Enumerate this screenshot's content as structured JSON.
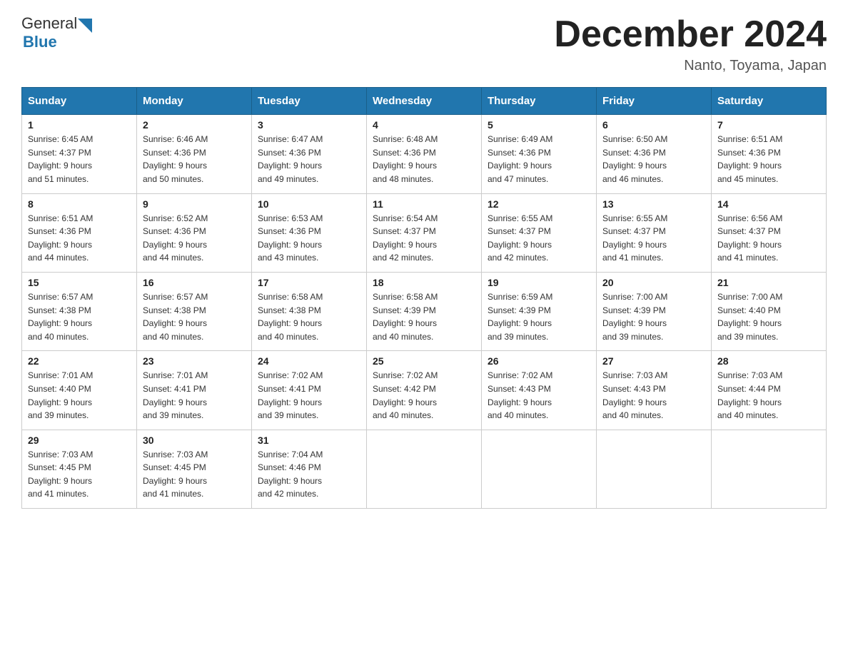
{
  "header": {
    "logo_general": "General",
    "logo_blue": "Blue",
    "month_title": "December 2024",
    "location": "Nanto, Toyama, Japan"
  },
  "columns": [
    "Sunday",
    "Monday",
    "Tuesday",
    "Wednesday",
    "Thursday",
    "Friday",
    "Saturday"
  ],
  "weeks": [
    [
      {
        "day": "1",
        "sunrise": "6:45 AM",
        "sunset": "4:37 PM",
        "daylight": "9 hours and 51 minutes."
      },
      {
        "day": "2",
        "sunrise": "6:46 AM",
        "sunset": "4:36 PM",
        "daylight": "9 hours and 50 minutes."
      },
      {
        "day": "3",
        "sunrise": "6:47 AM",
        "sunset": "4:36 PM",
        "daylight": "9 hours and 49 minutes."
      },
      {
        "day": "4",
        "sunrise": "6:48 AM",
        "sunset": "4:36 PM",
        "daylight": "9 hours and 48 minutes."
      },
      {
        "day": "5",
        "sunrise": "6:49 AM",
        "sunset": "4:36 PM",
        "daylight": "9 hours and 47 minutes."
      },
      {
        "day": "6",
        "sunrise": "6:50 AM",
        "sunset": "4:36 PM",
        "daylight": "9 hours and 46 minutes."
      },
      {
        "day": "7",
        "sunrise": "6:51 AM",
        "sunset": "4:36 PM",
        "daylight": "9 hours and 45 minutes."
      }
    ],
    [
      {
        "day": "8",
        "sunrise": "6:51 AM",
        "sunset": "4:36 PM",
        "daylight": "9 hours and 44 minutes."
      },
      {
        "day": "9",
        "sunrise": "6:52 AM",
        "sunset": "4:36 PM",
        "daylight": "9 hours and 44 minutes."
      },
      {
        "day": "10",
        "sunrise": "6:53 AM",
        "sunset": "4:36 PM",
        "daylight": "9 hours and 43 minutes."
      },
      {
        "day": "11",
        "sunrise": "6:54 AM",
        "sunset": "4:37 PM",
        "daylight": "9 hours and 42 minutes."
      },
      {
        "day": "12",
        "sunrise": "6:55 AM",
        "sunset": "4:37 PM",
        "daylight": "9 hours and 42 minutes."
      },
      {
        "day": "13",
        "sunrise": "6:55 AM",
        "sunset": "4:37 PM",
        "daylight": "9 hours and 41 minutes."
      },
      {
        "day": "14",
        "sunrise": "6:56 AM",
        "sunset": "4:37 PM",
        "daylight": "9 hours and 41 minutes."
      }
    ],
    [
      {
        "day": "15",
        "sunrise": "6:57 AM",
        "sunset": "4:38 PM",
        "daylight": "9 hours and 40 minutes."
      },
      {
        "day": "16",
        "sunrise": "6:57 AM",
        "sunset": "4:38 PM",
        "daylight": "9 hours and 40 minutes."
      },
      {
        "day": "17",
        "sunrise": "6:58 AM",
        "sunset": "4:38 PM",
        "daylight": "9 hours and 40 minutes."
      },
      {
        "day": "18",
        "sunrise": "6:58 AM",
        "sunset": "4:39 PM",
        "daylight": "9 hours and 40 minutes."
      },
      {
        "day": "19",
        "sunrise": "6:59 AM",
        "sunset": "4:39 PM",
        "daylight": "9 hours and 39 minutes."
      },
      {
        "day": "20",
        "sunrise": "7:00 AM",
        "sunset": "4:39 PM",
        "daylight": "9 hours and 39 minutes."
      },
      {
        "day": "21",
        "sunrise": "7:00 AM",
        "sunset": "4:40 PM",
        "daylight": "9 hours and 39 minutes."
      }
    ],
    [
      {
        "day": "22",
        "sunrise": "7:01 AM",
        "sunset": "4:40 PM",
        "daylight": "9 hours and 39 minutes."
      },
      {
        "day": "23",
        "sunrise": "7:01 AM",
        "sunset": "4:41 PM",
        "daylight": "9 hours and 39 minutes."
      },
      {
        "day": "24",
        "sunrise": "7:02 AM",
        "sunset": "4:41 PM",
        "daylight": "9 hours and 39 minutes."
      },
      {
        "day": "25",
        "sunrise": "7:02 AM",
        "sunset": "4:42 PM",
        "daylight": "9 hours and 40 minutes."
      },
      {
        "day": "26",
        "sunrise": "7:02 AM",
        "sunset": "4:43 PM",
        "daylight": "9 hours and 40 minutes."
      },
      {
        "day": "27",
        "sunrise": "7:03 AM",
        "sunset": "4:43 PM",
        "daylight": "9 hours and 40 minutes."
      },
      {
        "day": "28",
        "sunrise": "7:03 AM",
        "sunset": "4:44 PM",
        "daylight": "9 hours and 40 minutes."
      }
    ],
    [
      {
        "day": "29",
        "sunrise": "7:03 AM",
        "sunset": "4:45 PM",
        "daylight": "9 hours and 41 minutes."
      },
      {
        "day": "30",
        "sunrise": "7:03 AM",
        "sunset": "4:45 PM",
        "daylight": "9 hours and 41 minutes."
      },
      {
        "day": "31",
        "sunrise": "7:04 AM",
        "sunset": "4:46 PM",
        "daylight": "9 hours and 42 minutes."
      },
      null,
      null,
      null,
      null
    ]
  ],
  "labels": {
    "sunrise_prefix": "Sunrise: ",
    "sunset_prefix": "Sunset: ",
    "daylight_prefix": "Daylight: "
  }
}
